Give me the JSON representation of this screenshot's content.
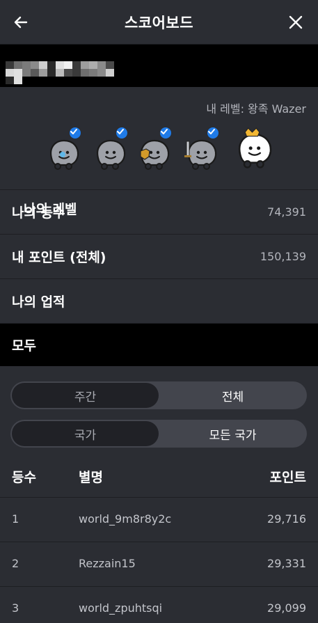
{
  "header": {
    "title": "스코어보드",
    "back_icon": "arrow-left-icon",
    "close_icon": "close-icon"
  },
  "level": {
    "label": "나의 레벨",
    "value": "내 레벨: 왕족 Wazer",
    "badges": [
      {
        "name": "baby-wazer-icon",
        "completed": true
      },
      {
        "name": "grown-up-wazer-icon",
        "completed": true
      },
      {
        "name": "warrior-wazer-icon",
        "completed": true
      },
      {
        "name": "knight-wazer-icon",
        "completed": true
      },
      {
        "name": "royalty-wazer-icon",
        "completed": false
      }
    ]
  },
  "rank": {
    "label": "나의 등수",
    "value": "74,391"
  },
  "points": {
    "label": "내 포인트 (전체)",
    "value": "150,139"
  },
  "achievements": {
    "label": "나의 업적"
  },
  "section": {
    "label": "모두"
  },
  "period_toggle": {
    "left": "주간",
    "right": "전체",
    "selected": "전체"
  },
  "region_toggle": {
    "left": "국가",
    "right": "모든 국가",
    "selected": "모든 국가"
  },
  "table": {
    "headers": {
      "rank": "등수",
      "name": "별명",
      "points": "포인트"
    },
    "rows": [
      {
        "rank": "1",
        "name": "world_9m8r8y2c",
        "points": "29,716"
      },
      {
        "rank": "2",
        "name": "Rezzain15",
        "points": "29,331"
      },
      {
        "rank": "3",
        "name": "world_zpuhtsqi",
        "points": "29,099"
      }
    ]
  },
  "colors": {
    "background": "#2b2d33",
    "dark": "#000000",
    "accent": "#1f7be8",
    "crown": "#f2b632"
  }
}
